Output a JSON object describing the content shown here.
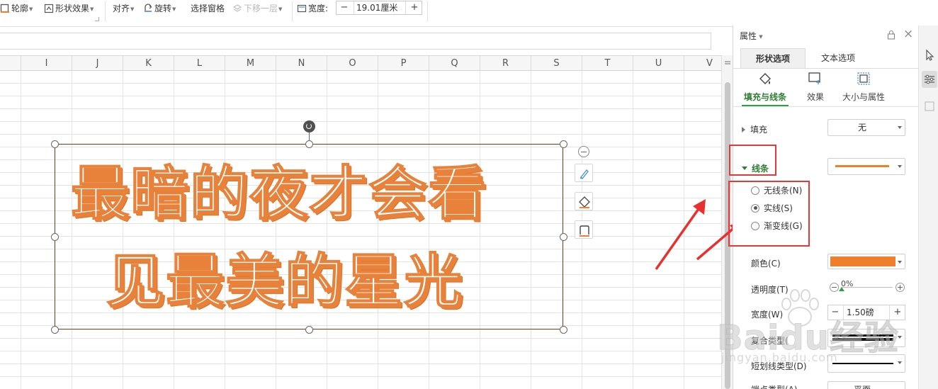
{
  "toolbar": {
    "outline_label": "轮廓",
    "shape_effect_label": "形状效果",
    "align_label": "对齐",
    "rotate_label": "旋转",
    "selection_pane_label": "选择窗格",
    "move_down_label": "下移一层",
    "width_label": "宽度:",
    "width_value": "19.01厘米",
    "minus": "−",
    "plus": "+"
  },
  "sheet": {
    "columns": [
      "I",
      "J",
      "K",
      "L",
      "M",
      "N",
      "O",
      "P",
      "Q",
      "R",
      "S",
      "T",
      "U",
      "V"
    ]
  },
  "wordart": {
    "line1": "最暗的夜才会看",
    "line2": "见最美的星光",
    "text_color": "#ffffff",
    "outline_color": "#e8823a"
  },
  "panel": {
    "title": "属性",
    "tabs": [
      "形状选项",
      "文本选项"
    ],
    "subtabs": [
      "填充与线条",
      "效果",
      "大小与属性"
    ],
    "fill_label": "填充",
    "fill_value": "无",
    "line_label": "线条",
    "line_options": [
      "无线条(N)",
      "实线(S)",
      "渐变线(G)"
    ],
    "selected_line_option": "实线(S)",
    "color_label": "颜色(C)",
    "line_color": "#ee7f2d",
    "transparency_label": "透明度(T)",
    "transparency_value": "0%",
    "width_label": "宽度(W)",
    "width_value": "1.50磅",
    "compound_label": "复合类型(",
    "dash_label": "短划线类型(D)",
    "cap_label": "端点类型(A)",
    "cap_value": "平面"
  },
  "accent": {
    "green": "#2e7d32",
    "red_annotation": "#e23a3a"
  },
  "watermark": {
    "text": "Baidu经验",
    "sub": "jingyan.baidu.com"
  }
}
